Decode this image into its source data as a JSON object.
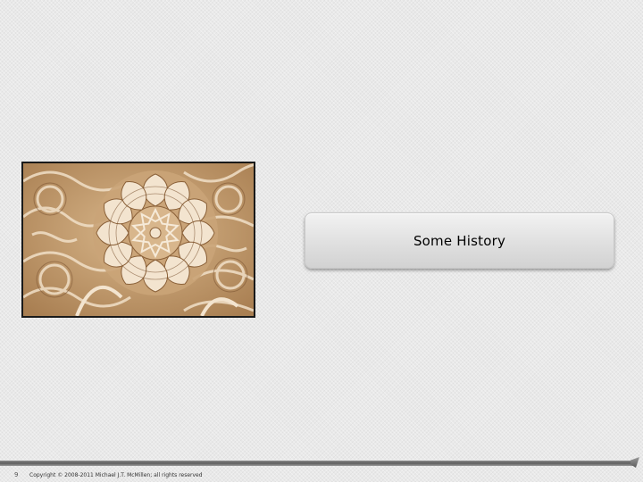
{
  "slide": {
    "title": "Some History",
    "number": "9",
    "copyright": "Copyright © 2008-2011 Michael J.T. McMillen; all rights reserved"
  },
  "image": {
    "subject": "arabesque-plaster-carving",
    "colors": {
      "base": "#c9a57a",
      "light": "#f3e4cf",
      "shadow": "#7a5230"
    }
  },
  "colors": {
    "background": "#e9e9e9",
    "title_box": "#dedede",
    "footer_bar": "#6e6e6e"
  }
}
